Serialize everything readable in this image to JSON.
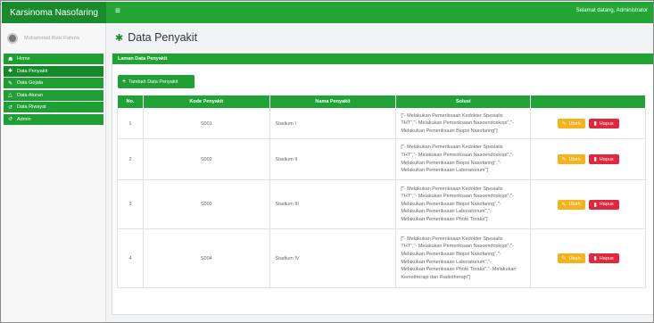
{
  "app": {
    "brand": "Karsinoma Nasofaring",
    "menu_icon": "hamburger-icon",
    "welcome": "Selamat datang, Administrator"
  },
  "user": {
    "name": "Muhammad Rizki Rahma"
  },
  "sidebar": {
    "items": [
      {
        "label": "Home",
        "icon": "home-icon"
      },
      {
        "label": "Data Penyakit",
        "icon": "disease-icon"
      },
      {
        "label": "Data Gejala",
        "icon": "pencil-icon"
      },
      {
        "label": "Data Aturan",
        "icon": "rule-icon"
      },
      {
        "label": "Data Riwayat",
        "icon": "history-icon"
      },
      {
        "label": "Admin",
        "icon": "admin-icon"
      }
    ]
  },
  "page": {
    "title": "Data Penyakit"
  },
  "panel": {
    "title": "Laman Data Penyakit",
    "add_label": "Tambah Data Penyakit"
  },
  "table": {
    "headers": [
      "No.",
      "Kode Penyakit",
      "Nama Penyakit",
      "Solusi",
      ""
    ],
    "edit_label": "Ubah",
    "delete_label": "Hapus",
    "rows": [
      {
        "no": "1",
        "kode": "S001",
        "nama": "Stadium I",
        "solusi": [
          "[\"- Melakukan Pemeriksaan Kedokter Spesialis",
          "THT\",\"- Melakukan Pemeriksaan Nasoendoskopi\",\"-",
          "Melakukan Pemeriksaan Biopsi Nasofaring\"]"
        ]
      },
      {
        "no": "2",
        "kode": "S002",
        "nama": "Stadium II",
        "solusi": [
          "[\"- Melakukan Pemeriksaan Kedokter Spesialis",
          "THT\",\"- Melakukan Pemeriksaan Nasoendoskopi\",\"-",
          "Melakukan Pemeriksaan Biopsi Nasofaring\",\"-",
          "Melakukan Pemeriksaan Laboratorium\"]"
        ]
      },
      {
        "no": "3",
        "kode": "S003",
        "nama": "Stadium III",
        "solusi": [
          "[\"- Melakukan Pemeriksaan Kedokter Spesialis",
          "THT\",\"- Melakukan Pemeriksaan Nasoendoskopi\",\"-",
          "Melakukan Pemeriksaan Biopsi Nasofaring\",\"-",
          "Melakukan Pemeriksaan Laboratorium\",\"-",
          "Melakukan Pemeriksaan Photo Toraks\"]"
        ]
      },
      {
        "no": "4",
        "kode": "S004",
        "nama": "Stadium IV",
        "solusi": [
          "[\"- Melakukan Pemeriksaan Kedokter Spesialis",
          "THT\",\"- Melakukan Pemeriksaan Nasoendoskopi\",\"-",
          "Melakukan Pemeriksaan Biopsi Nasofaring\",\"-",
          "Melakukan Pemeriksaan Laboratorium\",\"-",
          "Melakukan Pemeriksaan Photo Toraks\",\"- Melakukan",
          "Kemotherapi dan Radiotherapi\"]"
        ]
      }
    ]
  },
  "colors": {
    "header_dark": "#1a8a2f",
    "header": "#23a636",
    "edit": "#f6b21b",
    "delete": "#e0273d"
  }
}
